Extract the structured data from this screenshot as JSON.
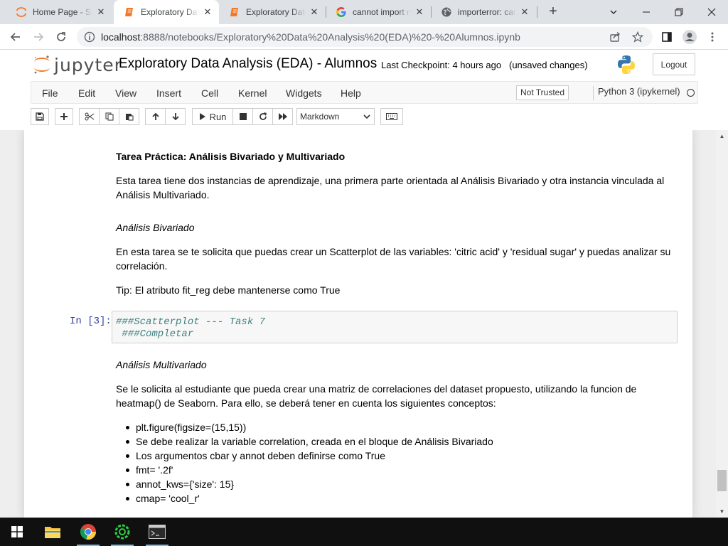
{
  "browser": {
    "tabs": [
      {
        "title": "Home Page - Se",
        "icon": "jupyter-icon",
        "active": false
      },
      {
        "title": "Exploratory Data",
        "icon": "notebook-icon",
        "active": true
      },
      {
        "title": "Exploratory Data",
        "icon": "notebook-icon",
        "active": false
      },
      {
        "title": "cannot import n",
        "icon": "google-icon",
        "active": false
      },
      {
        "title": "importerror: can",
        "icon": "globe-icon",
        "active": false
      }
    ],
    "url_host": "localhost",
    "url_rest": ":8888/notebooks/Exploratory%20Data%20Analysis%20(EDA)%20-%20Alumnos.ipynb"
  },
  "header": {
    "logo_text": "jupyter",
    "notebook_title": "Exploratory Data Analysis (EDA) - Alumnos",
    "checkpoint": "Last Checkpoint: 4 hours ago",
    "unsaved": "(unsaved changes)",
    "logout_label": "Logout"
  },
  "menubar": {
    "items": [
      "File",
      "Edit",
      "View",
      "Insert",
      "Cell",
      "Kernel",
      "Widgets",
      "Help"
    ],
    "trust_label": "Not Trusted",
    "kernel_label": "Python 3 (ipykernel)"
  },
  "toolbar": {
    "run_label": "Run",
    "cell_type": "Markdown"
  },
  "notebook": {
    "task_title": "Tarea Práctica: Análisis Bivariado y Multivariado",
    "intro_line1": "Esta tarea tiene dos instancias de aprendizaje, una primera parte orientada al Análisis Bivariado y otra instancia vinculada al",
    "intro_line2": "Análisis Multivariado.",
    "bivariado_heading": "Análisis Bivariado",
    "bivariado_line1": "En esta tarea se te solicita que puedas crear un Scatterplot de las variables: 'citric acid' y 'residual sugar' y puedas analizar su",
    "bivariado_line2": "correlación.",
    "tip": "Tip: El atributo fit_reg debe mantenerse como True",
    "code_prompt": "In [3]:",
    "code_line1": "###Scatterplot --- Task 7",
    "code_line2": " ###Completar",
    "multivariado_heading": "Análisis Multivariado",
    "multivariado_line1": "Se le solicita al estudiante que pueda crear una matriz de correlaciones del dataset propuesto, utilizando la funcion de",
    "multivariado_line2": "heatmap() de Seaborn. Para ello, se deberá tener en cuenta los siguientes conceptos:",
    "bullets": [
      "plt.figure(figsize=(15,15))",
      "Se debe realizar la variable correlation, creada en el bloque de Análisis Bivariado",
      "Los argumentos cbar y annot deben definirse como True",
      "fmt= '.2f'",
      "annot_kws={'size': 15}",
      "cmap= 'cool_r'"
    ]
  },
  "colors": {
    "prompt": "#303f9f",
    "code_comment": "#408080",
    "jupyter_orange": "#f37726"
  }
}
